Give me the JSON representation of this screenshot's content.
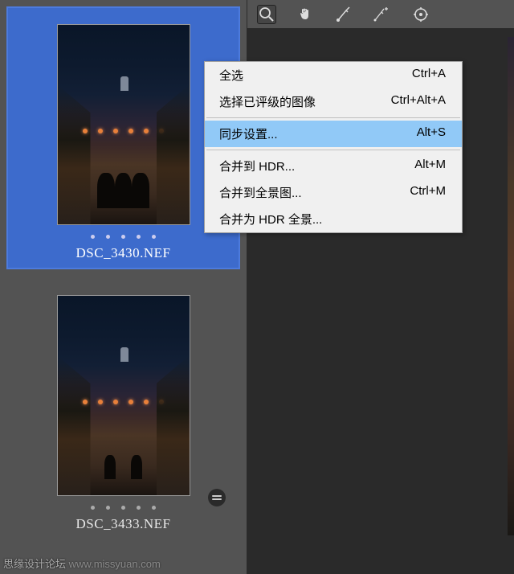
{
  "thumbnails": [
    {
      "filename": "DSC_3430.NEF",
      "selected": true
    },
    {
      "filename": "DSC_3433.NEF",
      "selected": false
    }
  ],
  "context_menu": {
    "items": [
      {
        "label": "全选",
        "shortcut": "Ctrl+A",
        "highlighted": false
      },
      {
        "label": "选择已评级的图像",
        "shortcut": "Ctrl+Alt+A",
        "highlighted": false
      },
      {
        "divider": true
      },
      {
        "label": "同步设置...",
        "shortcut": "Alt+S",
        "highlighted": true
      },
      {
        "divider": true
      },
      {
        "label": "合并到 HDR...",
        "shortcut": "Alt+M",
        "highlighted": false
      },
      {
        "label": "合并到全景图...",
        "shortcut": "Ctrl+M",
        "highlighted": false
      },
      {
        "label": "合并为 HDR 全景...",
        "shortcut": "",
        "highlighted": false
      }
    ]
  },
  "watermark": "思缘设计论坛",
  "watermark_url": "www.missyuan.com"
}
